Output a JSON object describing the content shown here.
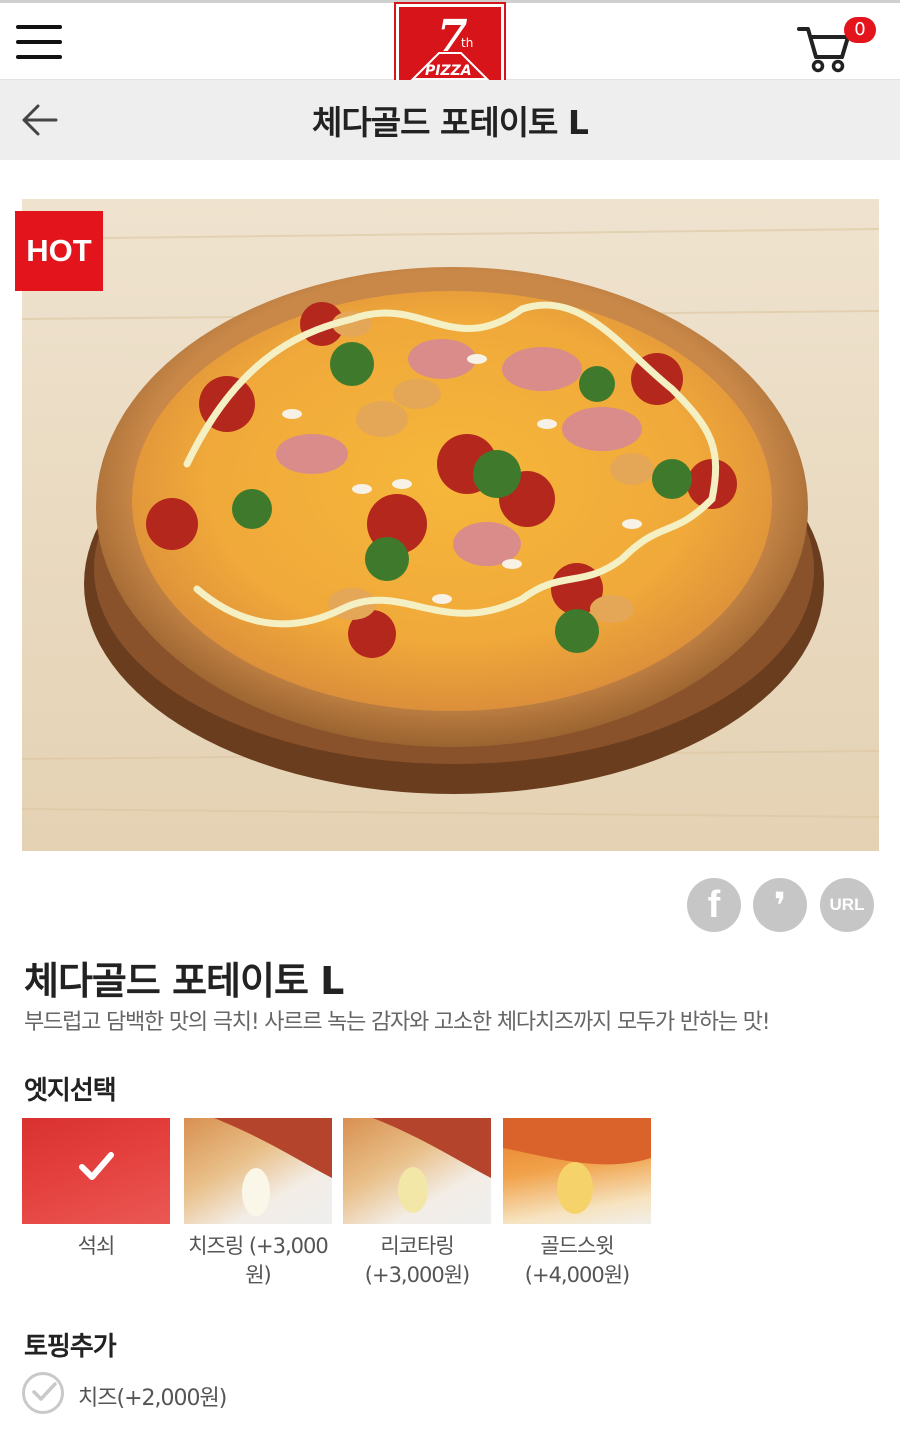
{
  "header": {
    "logo_text": "7th PIZZA",
    "cart_count": "0"
  },
  "subheader": {
    "title": "체다골드 포테이토 L"
  },
  "product": {
    "badge": "HOT",
    "name": "체다골드 포테이토 L",
    "description": "부드럽고 담백한 맛의 극치! 사르르 녹는 감자와 고소한 체다치즈까지 모두가 반하는 맛!"
  },
  "share": {
    "facebook": "f",
    "kakao": "❜",
    "url": "URL"
  },
  "edge_section": {
    "title": "엣지선택",
    "options": [
      {
        "label": "석쇠",
        "selected": true
      },
      {
        "label": "치즈링 (+3,000원)",
        "selected": false
      },
      {
        "label": "리코타링\n(+3,000원)",
        "selected": false
      },
      {
        "label": "골드스윗\n(+4,000원)",
        "selected": false
      }
    ]
  },
  "topping_section": {
    "title": "토핑추가",
    "items": [
      {
        "label": "치즈(+2,000원)",
        "checked": false
      }
    ]
  },
  "colors": {
    "brand_red": "#e3141b",
    "header_gray": "#eeeeee",
    "share_gray": "#c6c6c6"
  }
}
